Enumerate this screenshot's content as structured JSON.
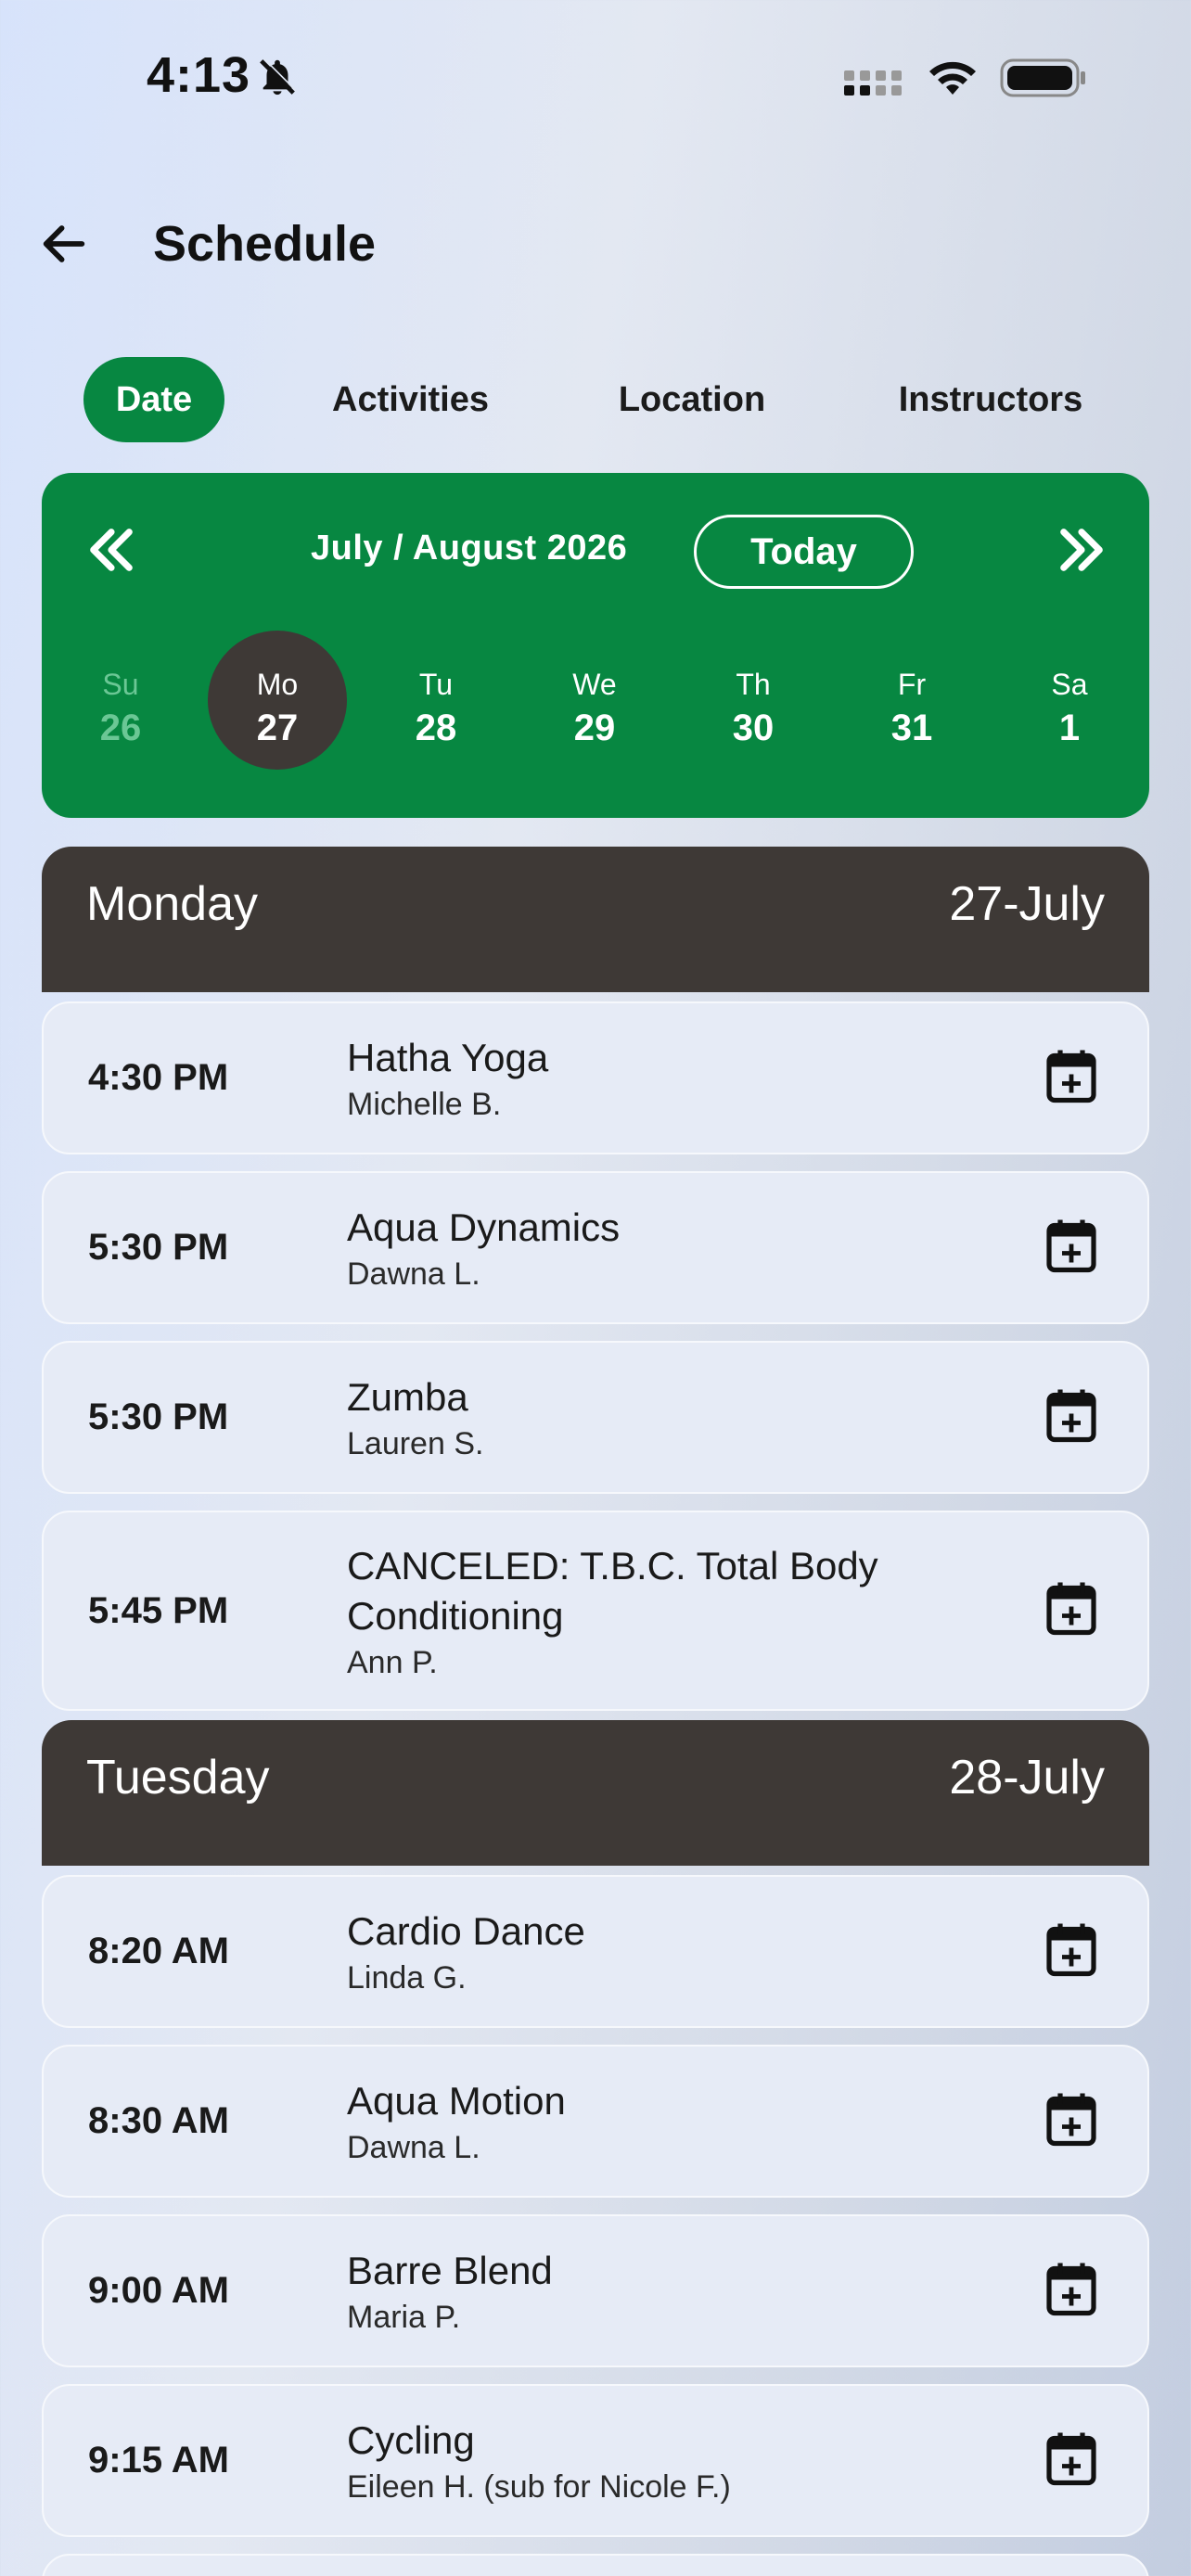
{
  "status_bar": {
    "time": "4:13"
  },
  "header": {
    "title": "Schedule"
  },
  "tabs": [
    {
      "label": "Date",
      "active": true
    },
    {
      "label": "Activities",
      "active": false
    },
    {
      "label": "Location",
      "active": false
    },
    {
      "label": "Instructors",
      "active": false
    }
  ],
  "calendar": {
    "month_label": "July / August 2026",
    "today_label": "Today",
    "days": [
      {
        "name": "Su",
        "date": "26",
        "state": "past"
      },
      {
        "name": "Mo",
        "date": "27",
        "state": "selected"
      },
      {
        "name": "Tu",
        "date": "28",
        "state": "normal"
      },
      {
        "name": "We",
        "date": "29",
        "state": "normal"
      },
      {
        "name": "Th",
        "date": "30",
        "state": "normal"
      },
      {
        "name": "Fr",
        "date": "31",
        "state": "normal"
      },
      {
        "name": "Sa",
        "date": "1",
        "state": "normal"
      }
    ]
  },
  "schedule": [
    {
      "day": "Monday",
      "date": "27-July",
      "classes": [
        {
          "time": "4:30 PM",
          "name": "Hatha Yoga",
          "instructor": "Michelle B."
        },
        {
          "time": "5:30 PM",
          "name": "Aqua Dynamics",
          "instructor": "Dawna L."
        },
        {
          "time": "5:30 PM",
          "name": "Zumba",
          "instructor": "Lauren S."
        },
        {
          "time": "5:45 PM",
          "name": "CANCELED: T.B.C. Total Body Conditioning",
          "instructor": "Ann P."
        }
      ]
    },
    {
      "day": "Tuesday",
      "date": "28-July",
      "classes": [
        {
          "time": "8:20 AM",
          "name": "Cardio Dance",
          "instructor": "Linda G."
        },
        {
          "time": "8:30 AM",
          "name": "Aqua Motion",
          "instructor": "Dawna L."
        },
        {
          "time": "9:00 AM",
          "name": "Barre Blend",
          "instructor": "Maria P."
        },
        {
          "time": "9:15 AM",
          "name": "Cycling",
          "instructor": "Eileen H. (sub for Nicole F.)"
        }
      ]
    }
  ],
  "icons": {
    "back": "arrow-left-icon",
    "prev": "double-chevron-left-icon",
    "next": "double-chevron-right-icon",
    "add": "calendar-plus-icon",
    "bell": "bell-slash-icon",
    "signal": "cellular-signal-icon",
    "wifi": "wifi-icon",
    "battery": "battery-icon"
  },
  "colors": {
    "accent": "#078741",
    "dark": "#3e3936",
    "card": "#e6ebf6"
  }
}
